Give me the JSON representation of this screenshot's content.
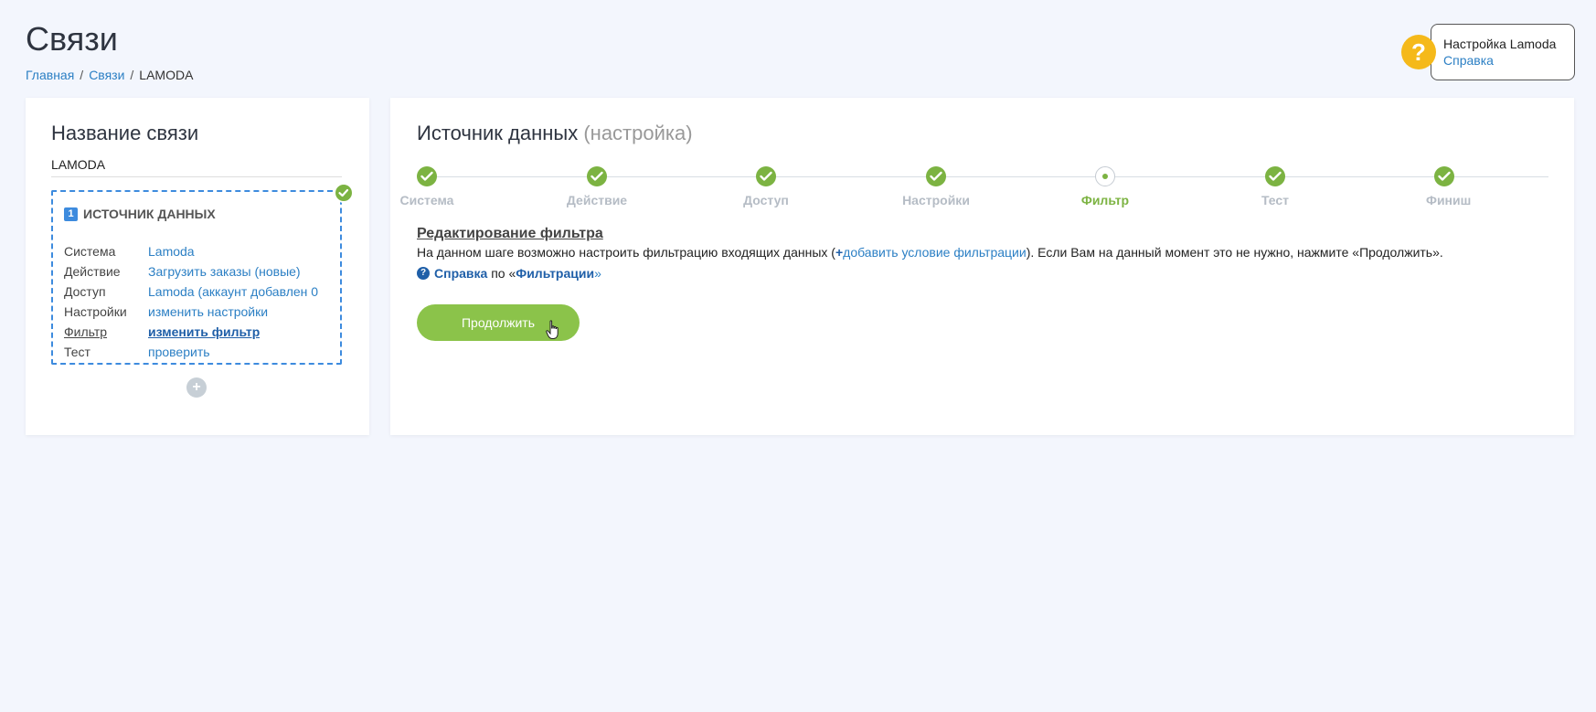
{
  "page": {
    "title": "Связи",
    "breadcrumb": [
      "Главная",
      "Связи",
      "LAMODA"
    ]
  },
  "help_box": {
    "title": "Настройка Lamoda",
    "link": "Справка",
    "icon": "question-icon"
  },
  "left": {
    "title": "Название связи",
    "name_value": "LAMODA",
    "step": {
      "number": "1",
      "title": "ИСТОЧНИК ДАННЫХ",
      "rows": [
        {
          "key": "Система",
          "value": "Lamoda"
        },
        {
          "key": "Действие",
          "value": "Загрузить заказы (новые)"
        },
        {
          "key": "Доступ",
          "value": "Lamoda (аккаунт добавлен 0"
        },
        {
          "key": "Настройки",
          "value": "изменить настройки"
        },
        {
          "key": "Фильтр",
          "value": "изменить фильтр"
        },
        {
          "key": "Тест",
          "value": "проверить"
        }
      ]
    },
    "add_icon": "plus-icon"
  },
  "right": {
    "title": "Источник данных",
    "title_sub": "(настройка)",
    "steps": [
      "Система",
      "Действие",
      "Доступ",
      "Настройки",
      "Фильтр",
      "Тест",
      "Финиш"
    ],
    "current_step": "Фильтр",
    "edit_title": "Редактирование фильтра",
    "desc_before": "На данном шаге возможно настроить фильтрацию входящих данных (",
    "desc_plus": "+",
    "desc_link": "добавить условие фильтрации",
    "desc_after": "). Если Вам на данный момент это не нужно, нажмите «Продолжить».",
    "help_bold": "Справка",
    "help_mid": " по «",
    "help_link": "Фильтрации",
    "help_end": "»",
    "continue_label": "Продолжить"
  },
  "colors": {
    "accent_green": "#8bc34a",
    "link_blue": "#2b7fc4",
    "dashed_blue": "#3d8bde",
    "help_yellow": "#f5b91a"
  }
}
